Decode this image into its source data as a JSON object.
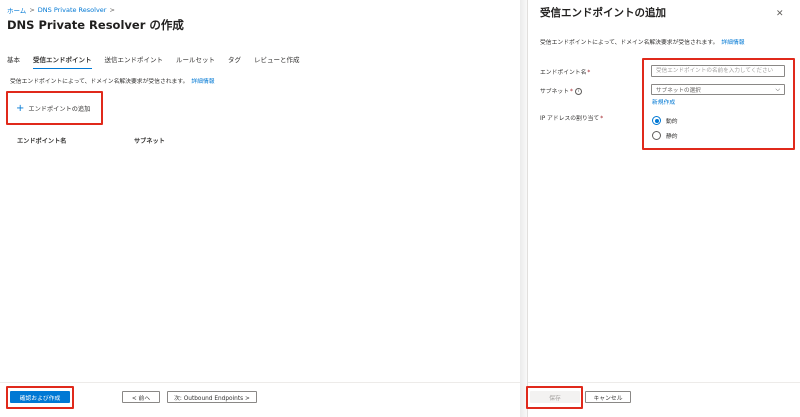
{
  "breadcrumb": {
    "home": "ホーム",
    "sep1": ">",
    "parent": "DNS Private Resolver",
    "sep2": ">"
  },
  "page": {
    "title": "DNS Private Resolver の作成",
    "more": "···"
  },
  "tabs": [
    {
      "label": "基本",
      "active": false
    },
    {
      "label": "受信エンドポイント",
      "active": true
    },
    {
      "label": "送信エンドポイント",
      "active": false
    },
    {
      "label": "ルールセット",
      "active": false
    },
    {
      "label": "タグ",
      "active": false
    },
    {
      "label": "レビューと作成",
      "active": false
    }
  ],
  "main": {
    "description": "受信エンドポイントによって、ドメイン名解決要求が受信されます。",
    "learn_more": "詳細情報",
    "add_endpoint_icon": "+",
    "add_endpoint_label": "エンドポイントの追加",
    "table_headers": [
      "エンドポイント名",
      "サブネット"
    ]
  },
  "footer": {
    "review_create": "確認および作成",
    "previous": "< 前へ",
    "next": "次: Outbound Endpoints >"
  },
  "panel": {
    "title": "受信エンドポイントの追加",
    "close_icon": "✕",
    "description": "受信エンドポイントによって、ドメイン名解決要求が受信されます。",
    "learn_more": "詳細情報",
    "endpoint_name_label": "エンドポイント名",
    "endpoint_name_placeholder": "受信エンドポイントの名前を入力してください",
    "subnet_label": "サブネット",
    "subnet_placeholder": "サブネットの選択",
    "subnet_chevron": "⌵",
    "info_icon": "i",
    "new_link": "新規作成",
    "ip_label": "IP アドレスの割り当て",
    "required_mark": "*",
    "ip_options": [
      {
        "label": "動的",
        "checked": true
      },
      {
        "label": "静的",
        "checked": false
      }
    ],
    "save": "保存",
    "cancel": "キャンセル"
  },
  "colors": {
    "accent": "#0078d4",
    "highlight": "#e0291b",
    "required": "#a4262c"
  }
}
